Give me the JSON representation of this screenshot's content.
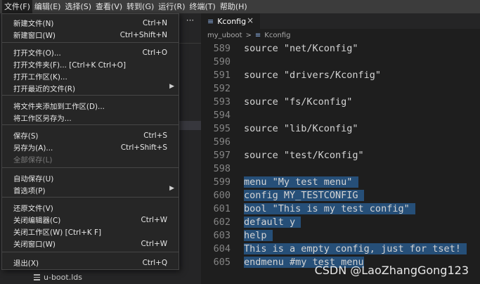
{
  "menubar": {
    "items": [
      {
        "label": "文件(F)",
        "active": true
      },
      {
        "label": "编辑(E)"
      },
      {
        "label": "选择(S)"
      },
      {
        "label": "查看(V)"
      },
      {
        "label": "转到(G)"
      },
      {
        "label": "运行(R)"
      },
      {
        "label": "终端(T)"
      },
      {
        "label": "帮助(H)"
      }
    ]
  },
  "sidebar": {
    "more_label": "···",
    "file_label": "u-boot.lds"
  },
  "tab": {
    "label": "Kconfig",
    "close": "×",
    "icon": "≡"
  },
  "breadcrumb": {
    "folder": "my_uboot",
    "sep": ">",
    "icon": "≡",
    "file": "Kconfig"
  },
  "file_menu": {
    "items": [
      {
        "label": "新建文件(N)",
        "shortcut": "Ctrl+N"
      },
      {
        "label": "新建窗口(W)",
        "shortcut": "Ctrl+Shift+N"
      },
      {
        "label": "打开文件(O)...",
        "shortcut": "Ctrl+O"
      },
      {
        "label": "打开文件夹(F)... [Ctrl+K Ctrl+O]",
        "shortcut": ""
      },
      {
        "label": "打开工作区(K)...",
        "shortcut": ""
      },
      {
        "label": "打开最近的文件(R)",
        "shortcut": "",
        "submenu": "▶"
      },
      {
        "label": "将文件夹添加到工作区(D)...",
        "shortcut": ""
      },
      {
        "label": "将工作区另存为...",
        "shortcut": ""
      },
      {
        "label": "保存(S)",
        "shortcut": "Ctrl+S"
      },
      {
        "label": "另存为(A)...",
        "shortcut": "Ctrl+Shift+S"
      },
      {
        "label": "全部保存(L)",
        "shortcut": "",
        "disabled": true
      },
      {
        "label": "自动保存(U)",
        "shortcut": ""
      },
      {
        "label": "首选项(P)",
        "shortcut": "",
        "submenu": "▶"
      },
      {
        "label": "还原文件(V)",
        "shortcut": ""
      },
      {
        "label": "关闭编辑器(C)",
        "shortcut": "Ctrl+W"
      },
      {
        "label": "关闭工作区(W) [Ctrl+K F]",
        "shortcut": ""
      },
      {
        "label": "关闭窗口(W)",
        "shortcut": "Ctrl+W"
      },
      {
        "label": "退出(X)",
        "shortcut": "Ctrl+Q"
      }
    ]
  },
  "editor": {
    "lines": [
      {
        "num": "589",
        "text": "source \"net/Kconfig\""
      },
      {
        "num": "590",
        "text": ""
      },
      {
        "num": "591",
        "text": "source \"drivers/Kconfig\""
      },
      {
        "num": "592",
        "text": ""
      },
      {
        "num": "593",
        "text": "source \"fs/Kconfig\""
      },
      {
        "num": "594",
        "text": ""
      },
      {
        "num": "595",
        "text": "source \"lib/Kconfig\""
      },
      {
        "num": "596",
        "text": ""
      },
      {
        "num": "597",
        "text": "source \"test/Kconfig\""
      },
      {
        "num": "598",
        "text": ""
      },
      {
        "num": "599",
        "text": "menu \"My test menu\" ",
        "selected": true
      },
      {
        "num": "600",
        "text": "config MY_TESTCONFIG ",
        "selected": true
      },
      {
        "num": "601",
        "text": "bool \"This is my test config\" ",
        "selected": true
      },
      {
        "num": "602",
        "text": "default y ",
        "selected": true
      },
      {
        "num": "603",
        "text": "help ",
        "selected": true
      },
      {
        "num": "604",
        "text": "This is a empty config, just for tset! ",
        "selected": true
      },
      {
        "num": "605",
        "text": "endmenu #my test menu",
        "selected": true
      }
    ]
  },
  "watermark": "CSDN @LaoZhangGong123",
  "colors": {
    "selection": "#264f78",
    "menubar": "#3c3c3c",
    "editor_bg": "#1e1e1e"
  }
}
